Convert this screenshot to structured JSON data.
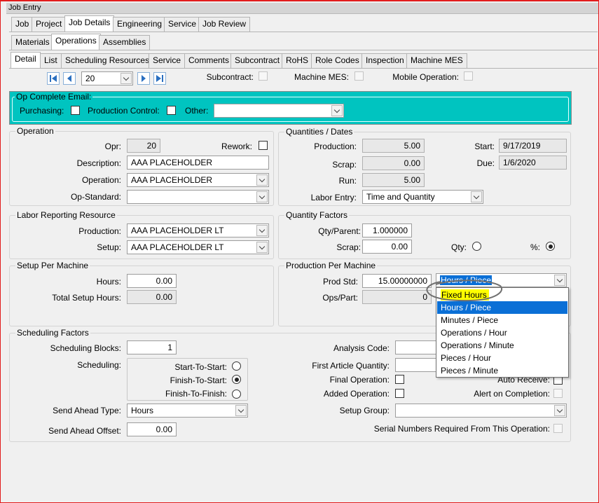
{
  "window": {
    "title": "Job Entry"
  },
  "top_tabs": [
    "Job",
    "Project",
    "Job Details",
    "Engineering",
    "Service",
    "Job Review"
  ],
  "sub_tabs": [
    "Materials",
    "Operations",
    "Assemblies"
  ],
  "detail_tabs": [
    "Detail",
    "List",
    "Scheduling Resources",
    "Service",
    "Comments",
    "Subcontract",
    "RoHS",
    "Role Codes",
    "Inspection",
    "Machine MES"
  ],
  "nav": {
    "current": "20",
    "subcontract_label": "Subcontract:",
    "machine_mes_label": "Machine MES:",
    "mobile_operation_label": "Mobile Operation:"
  },
  "op_email": {
    "title": "Op Complete Email:",
    "purchasing_label": "Purchasing:",
    "production_control_label": "Production Control:",
    "other_label": "Other:"
  },
  "operation": {
    "title": "Operation",
    "opr_label": "Opr:",
    "opr_value": "20",
    "rework_label": "Rework:",
    "description_label": "Description:",
    "description_value": "AAA PLACEHOLDER",
    "operation_label": "Operation:",
    "operation_value": "AAA PLACEHOLDER",
    "op_standard_label": "Op-Standard:",
    "op_standard_value": ""
  },
  "quantities": {
    "title": "Quantities / Dates",
    "production_label": "Production:",
    "production_value": "5.00",
    "scrap_label": "Scrap:",
    "scrap_value": "0.00",
    "run_label": "Run:",
    "run_value": "5.00",
    "labor_entry_label": "Labor Entry:",
    "labor_entry_value": "Time and Quantity",
    "start_label": "Start:",
    "start_value": "9/17/2019",
    "due_label": "Due:",
    "due_value": "1/6/2020"
  },
  "labor_resource": {
    "title": "Labor Reporting Resource",
    "production_label": "Production:",
    "production_value": "AAA PLACEHOLDER LT",
    "setup_label": "Setup:",
    "setup_value": "AAA PLACEHOLDER LT"
  },
  "quantity_factors": {
    "title": "Quantity Factors",
    "qty_parent_label": "Qty/Parent:",
    "qty_parent_value": "1.000000",
    "scrap_label": "Scrap:",
    "scrap_value": "0.00",
    "qty_label": "Qty:",
    "pct_label": "%:"
  },
  "setup_machine": {
    "title": "Setup Per Machine",
    "hours_label": "Hours:",
    "hours_value": "0.00",
    "total_label": "Total Setup Hours:",
    "total_value": "0.00"
  },
  "production_machine": {
    "title": "Production Per Machine",
    "prod_std_label": "Prod Std:",
    "prod_std_value": "15.00000000",
    "unit_value": "Hours / Piece",
    "ops_part_label": "Ops/Part:",
    "ops_part_value": "0"
  },
  "dropdown_options": [
    "Fixed Hours",
    "Hours / Piece",
    "Minutes / Piece",
    "Operations / Hour",
    "Operations / Minute",
    "Pieces / Hour",
    "Pieces / Minute"
  ],
  "dropdown_selected": "Hours / Piece",
  "scheduling": {
    "title": "Scheduling Factors",
    "blocks_label": "Scheduling Blocks:",
    "blocks_value": "1",
    "scheduling_label": "Scheduling:",
    "sts_label": "Start-To-Start:",
    "fts_label": "Finish-To-Start:",
    "ftf_label": "Finish-To-Finish:",
    "send_ahead_type_label": "Send Ahead Type:",
    "send_ahead_type_value": "Hours",
    "send_ahead_offset_label": "Send Ahead Offset:",
    "send_ahead_offset_value": "0.00",
    "analysis_code_label": "Analysis Code:",
    "first_article_label": "First Article Quantity:",
    "final_operation_label": "Final Operation:",
    "added_operation_label": "Added Operation:",
    "auto_receive_label": "Auto Receive:",
    "alert_completion_label": "Alert on Completion:",
    "setup_group_label": "Setup Group:",
    "serial_label": "Serial Numbers Required From This Operation:"
  },
  "colors": {
    "accent_teal": "#00c4c0",
    "selection_blue": "#0a6fd6",
    "highlight_yellow": "#ffff00",
    "frame_red": "#e21c1c"
  }
}
